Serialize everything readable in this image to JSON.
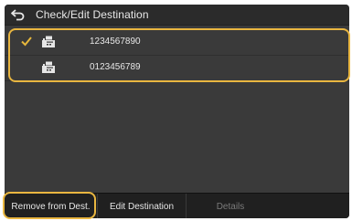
{
  "header": {
    "title": "Check/Edit Destination",
    "back_icon": "back-arrow-icon"
  },
  "destinations": [
    {
      "number": "1234567890",
      "selected": true,
      "icon": "fax-icon"
    },
    {
      "number": "0123456789",
      "selected": false,
      "icon": "fax-icon"
    }
  ],
  "footer": {
    "remove_label": "Remove from Dest.",
    "edit_label": "Edit Destination",
    "details_label": "Details"
  },
  "colors": {
    "highlight": "#e9b640",
    "check": "#e6b73c"
  }
}
